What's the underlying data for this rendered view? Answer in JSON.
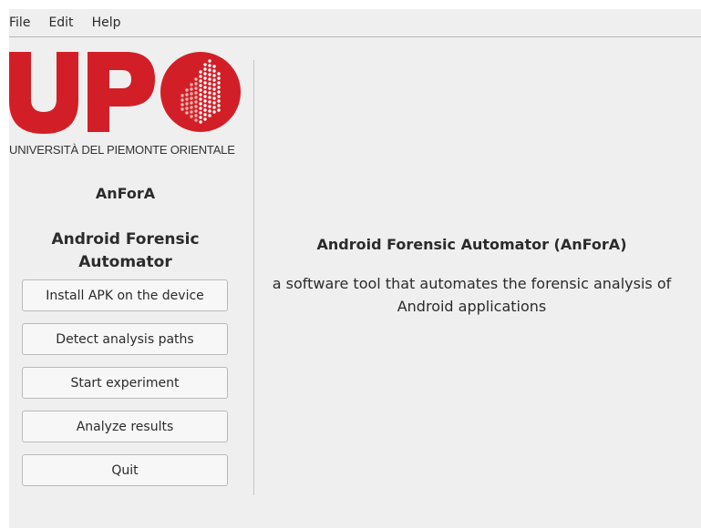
{
  "menubar": {
    "items": [
      "File",
      "Edit",
      "Help"
    ]
  },
  "logo": {
    "text": "UPO",
    "university": "UNIVERSITÀ DEL PIEMONTE ORIENTALE",
    "brand_color": "#d21f27"
  },
  "sidebar": {
    "app_short": "AnForA",
    "app_long": "Android Forensic Automator",
    "buttons": [
      "Install APK on the device",
      "Detect analysis paths",
      "Start experiment",
      "Analyze results",
      "Quit"
    ]
  },
  "content": {
    "title": "Android Forensic Automator (AnForA)",
    "description": "a software tool that automates the forensic analysis of Android applications"
  }
}
